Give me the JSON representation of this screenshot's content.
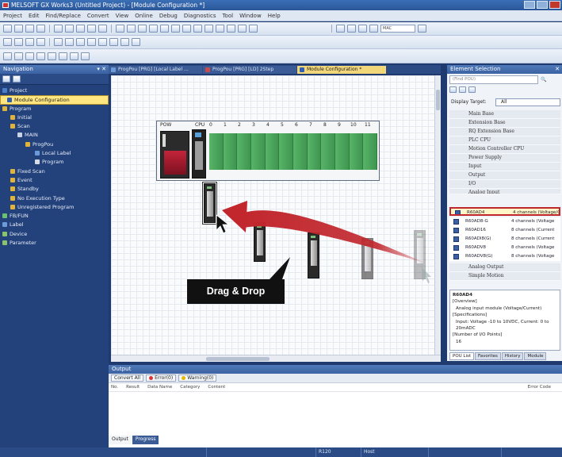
{
  "window": {
    "title": "MELSOFT GX Works3 (Untitled Project) - [Module Configuration *]"
  },
  "menu": [
    "Project",
    "Edit",
    "Find/Replace",
    "Convert",
    "View",
    "Online",
    "Debug",
    "Diagnostics",
    "Tool",
    "Window",
    "Help"
  ],
  "toolbar": {
    "combo_value": "MAC"
  },
  "navigation": {
    "title": "Navigation",
    "items": [
      {
        "label": "Project",
        "level": 0
      },
      {
        "label": "Module Configuration",
        "level": 1,
        "selected": true
      },
      {
        "label": "Program",
        "level": 0
      },
      {
        "label": "Initial",
        "level": 2
      },
      {
        "label": "Scan",
        "level": 2
      },
      {
        "label": "MAIN",
        "level": 3
      },
      {
        "label": "ProgPou",
        "level": 4
      },
      {
        "label": "Local Label",
        "level": 5
      },
      {
        "label": "Program",
        "level": 5
      },
      {
        "label": "Fixed Scan",
        "level": 2
      },
      {
        "label": "Event",
        "level": 2
      },
      {
        "label": "Standby",
        "level": 2
      },
      {
        "label": "No Execution Type",
        "level": 2
      },
      {
        "label": "Unregistered Program",
        "level": 2
      },
      {
        "label": "FB/FUN",
        "level": 0
      },
      {
        "label": "Label",
        "level": 0
      },
      {
        "label": "Device",
        "level": 0
      },
      {
        "label": "Parameter",
        "level": 0
      }
    ]
  },
  "tabs": [
    {
      "label": "ProgPou [PRG] [Local Label ..."
    },
    {
      "label": "ProgPou [PRG] [LD] 2Step"
    },
    {
      "label": "Module Configuration *",
      "active": true
    }
  ],
  "base": {
    "labels": [
      "POW",
      "CPU",
      "0",
      "1",
      "2",
      "3",
      "4",
      "5",
      "6",
      "7",
      "8",
      "9",
      "10",
      "11"
    ]
  },
  "drag_label": "Drag & Drop",
  "element_selection": {
    "title": "Element Selection",
    "search_placeholder": "(Find POU)",
    "search_button": "🔍",
    "display_target_label": "Display Target:",
    "display_target_value": "All",
    "categories_top": [
      "Main Base",
      "Extension Base",
      "RQ Extension Base",
      "PLC CPU",
      "Motion Controller CPU",
      "Power Supply",
      "Input",
      "Output",
      "I/O",
      "Analog Input"
    ],
    "items": [
      {
        "name": "R60AD4",
        "desc": "4 channels (Voltage/Current)",
        "highlight": true
      },
      {
        "name": "R60AD8-G",
        "desc": "4 channels (Voltage"
      },
      {
        "name": "R60AD16",
        "desc": "8 channels (Current"
      },
      {
        "name": "R60ADI8(G)",
        "desc": "8 channels (Current"
      },
      {
        "name": "R60ADV8",
        "desc": "8 channels (Voltage"
      },
      {
        "name": "R60ADV8(G)",
        "desc": "8 channels (Voltage"
      }
    ],
    "categories_bottom": [
      "Analog Output",
      "Simple Motion"
    ],
    "description": {
      "title": "R60AD4",
      "lines": [
        "[Overview]",
        "Analog input module (Voltage/Current)",
        "[Specifications]",
        "Input: Voltage -10 to 10VDC, Current: 0 to 20mADC",
        "[Number of I/O Points]",
        "16"
      ]
    },
    "tabs": [
      "POU List",
      "Favorites",
      "History",
      "Module"
    ]
  },
  "output": {
    "title": "Output",
    "buttons": [
      "Convert All",
      "Error(0)",
      "Warning(0)"
    ],
    "columns": [
      "No.",
      "Result",
      "Data Name",
      "Category",
      "Content"
    ],
    "right_column": "Error Code",
    "tabs": [
      "Output",
      "Progress"
    ]
  },
  "status": {
    "cell1": "R120",
    "cell2": "Host"
  },
  "colors": {
    "accent_red": "#c1272d",
    "selection_yellow": "#ffe680",
    "module_green": "#4aa35a"
  }
}
